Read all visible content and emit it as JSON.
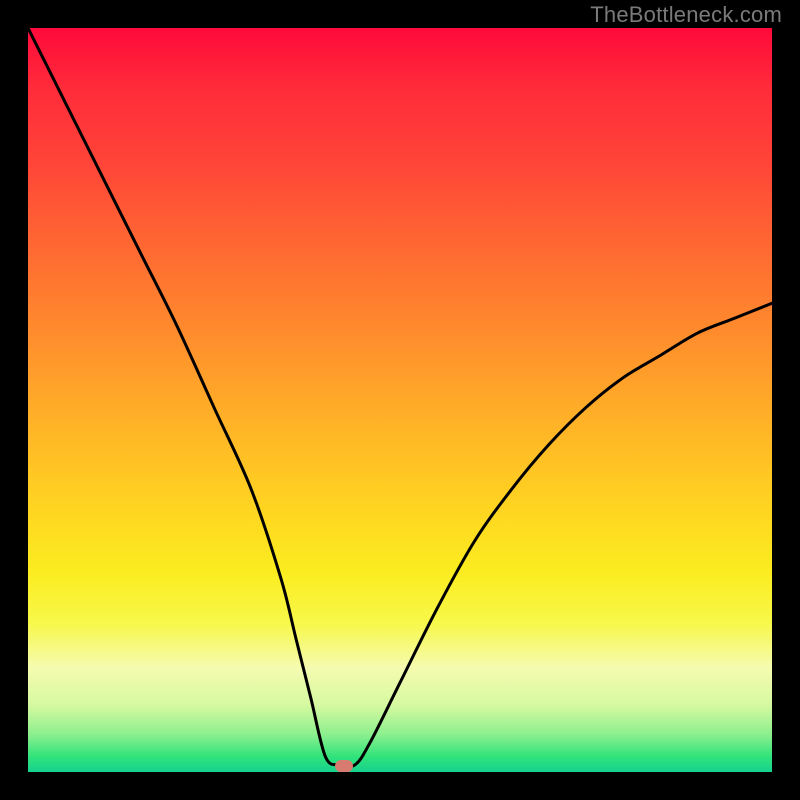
{
  "watermark": "TheBottleneck.com",
  "chart_data": {
    "type": "line",
    "title": "",
    "xlabel": "",
    "ylabel": "",
    "xlim": [
      0,
      100
    ],
    "ylim": [
      0,
      100
    ],
    "grid": false,
    "legend": false,
    "series": [
      {
        "name": "bottleneck-curve",
        "x": [
          0,
          5,
          10,
          15,
          20,
          25,
          30,
          34,
          36,
          38,
          40,
          42,
          44,
          46,
          50,
          55,
          60,
          65,
          70,
          75,
          80,
          85,
          90,
          95,
          100
        ],
        "y": [
          100,
          90,
          80,
          70,
          60,
          49,
          38,
          26,
          18,
          10,
          2,
          1,
          1,
          4,
          12,
          22,
          31,
          38,
          44,
          49,
          53,
          56,
          59,
          61,
          63
        ]
      }
    ],
    "marker": {
      "x": 42.5,
      "y": 0.8
    },
    "colors": {
      "curve": "#000000",
      "marker": "#d77a6f",
      "gradient_top": "#ff0a3a",
      "gradient_mid": "#ffd321",
      "gradient_bottom": "#16d18e",
      "frame": "#000000"
    }
  }
}
